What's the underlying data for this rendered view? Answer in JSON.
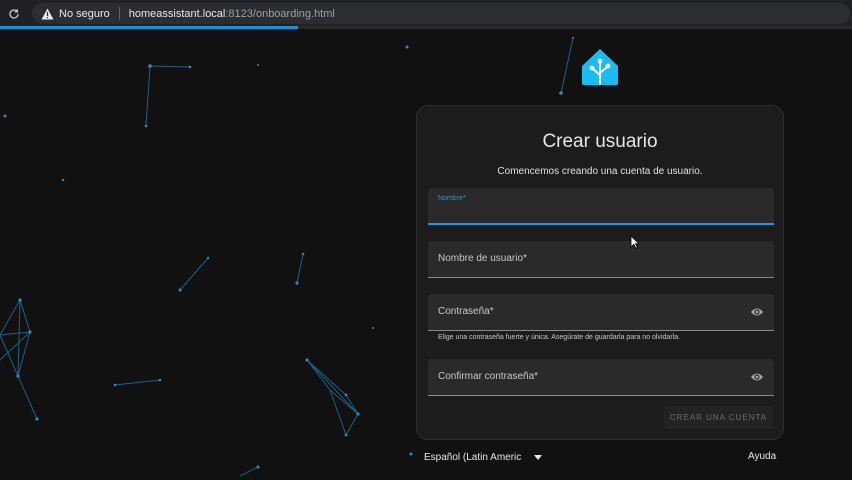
{
  "browser": {
    "not_secure_label": "No seguro",
    "url_host": "homeassistant.local",
    "url_path": ":8123/onboarding.html",
    "load_progress_percent": 35
  },
  "card": {
    "title": "Crear usuario",
    "subtitle": "Comencemos creando una cuenta de usuario.",
    "fields": {
      "name_label": "Nombre*",
      "username_label": "Nombre de usuario*",
      "password_label": "Contraseña*",
      "password_helper": "Elige una contraseña fuerte y única. Asegúrate de guardarla para no olvidarla.",
      "confirm_label": "Confirmar contraseña*"
    },
    "create_button_label": "CREAR UNA CUENTA"
  },
  "footer": {
    "language": "Español (Latin Americ",
    "help_label": "Ayuda"
  },
  "colors": {
    "accent": "#1e9ad8",
    "logo": "#18bcf2",
    "background": "#111111",
    "card": "#1c1c1c"
  }
}
